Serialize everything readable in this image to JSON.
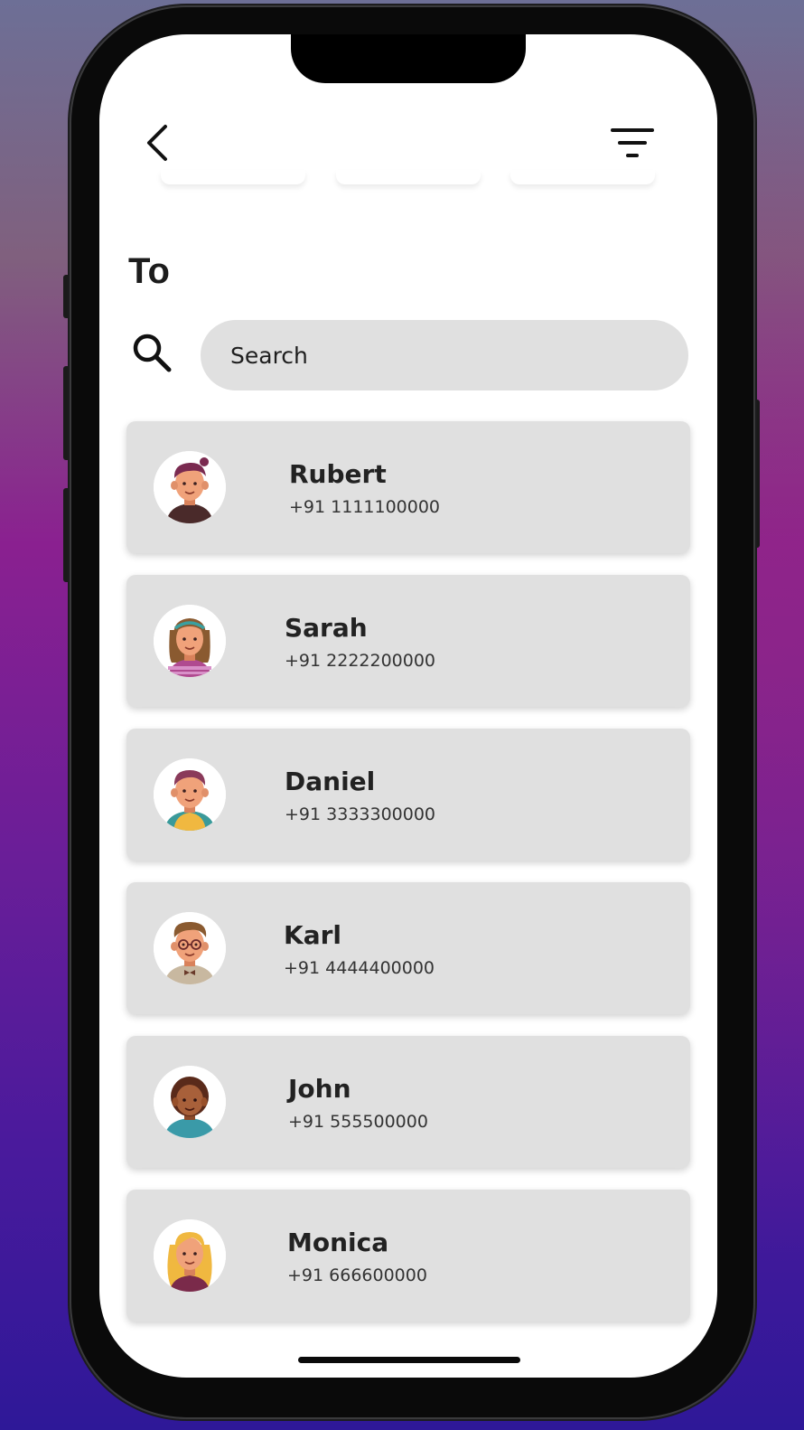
{
  "header": {
    "back_icon": "chevron-left-icon",
    "filter_icon": "filter-icon"
  },
  "recipient": {
    "label": "To"
  },
  "search": {
    "icon": "search-icon",
    "placeholder": "Search"
  },
  "contacts": [
    {
      "name": "Rubert",
      "phone": "+91 1111100000",
      "avatar": "avatar-man-maroon-hair"
    },
    {
      "name": "Sarah",
      "phone": "+91 2222200000",
      "avatar": "avatar-woman-headband"
    },
    {
      "name": "Daniel",
      "phone": "+91 3333300000",
      "avatar": "avatar-man-yellow-shirt"
    },
    {
      "name": "Karl",
      "phone": "+91 4444400000",
      "avatar": "avatar-man-glasses-bowtie"
    },
    {
      "name": "John",
      "phone": "+91 555500000",
      "avatar": "avatar-man-curly-hair"
    },
    {
      "name": "Monica",
      "phone": "+91 666600000",
      "avatar": "avatar-woman-blonde"
    }
  ],
  "colors": {
    "card_background": "#e0e0e0",
    "screen_background": "#ffffff",
    "text_primary": "#222222"
  }
}
